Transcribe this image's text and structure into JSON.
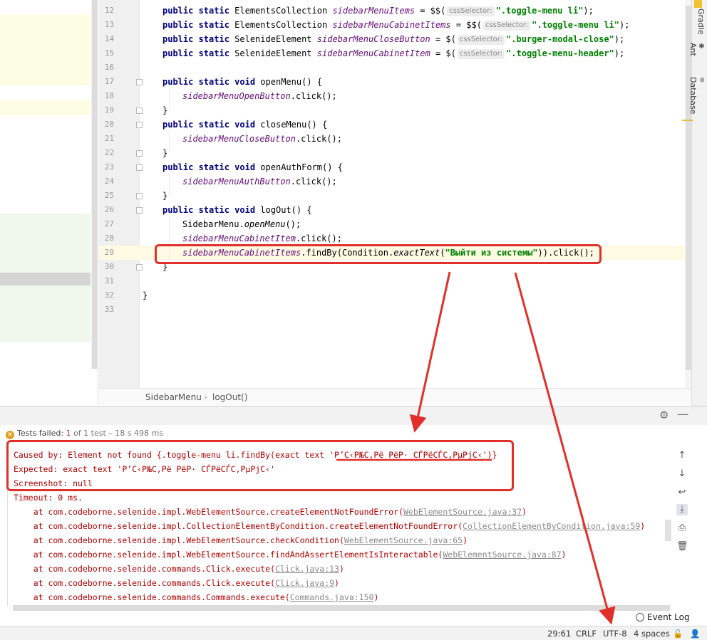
{
  "editor": {
    "lines": [
      {
        "num": "12"
      },
      {
        "num": "13"
      },
      {
        "num": "14"
      },
      {
        "num": "15"
      },
      {
        "num": "16"
      },
      {
        "num": "17"
      },
      {
        "num": "18"
      },
      {
        "num": "19"
      },
      {
        "num": "20"
      },
      {
        "num": "21"
      },
      {
        "num": "22"
      },
      {
        "num": "23"
      },
      {
        "num": "24"
      },
      {
        "num": "25"
      },
      {
        "num": "26"
      },
      {
        "num": "27"
      },
      {
        "num": "28"
      },
      {
        "num": "29"
      },
      {
        "num": "30"
      },
      {
        "num": "31"
      },
      {
        "num": "32"
      },
      {
        "num": "33"
      }
    ],
    "kw_public_static": "public static",
    "kw_void": "void",
    "t_elements_collection": "ElementsCollection",
    "t_selenide_element": "SelenideElement",
    "l12": {
      "field": "sidebarMenuItems",
      "op": " = $$(",
      "hint": "cssSelector:",
      "str": "\".toggle-menu li\"",
      "end": ");"
    },
    "l13": {
      "field": "sidebarMenuCabinetItems",
      "op": " = $$(",
      "hint": "cssSelector:",
      "str": "\".toggle-menu li\"",
      "end": ");"
    },
    "l14": {
      "field": "sidebarMenuCloseButton",
      "op": " = $(",
      "hint": "cssSelector:",
      "str": "\".burger-modal-close\"",
      "end": ");"
    },
    "l15": {
      "field": "sidebarMenuCabinetItem",
      "op": " = $(",
      "hint": "cssSelector:",
      "str": "\".toggle-menu-header\"",
      "end": ");"
    },
    "l17": {
      "method": "openMenu() {"
    },
    "l18": {
      "field": "sidebarMenuOpenButton",
      "rest": ".click();"
    },
    "l19": "}",
    "l20": {
      "method": "closeMenu() {"
    },
    "l21": {
      "field": "sidebarMenuCloseButton",
      "rest": ".click();"
    },
    "l22": "}",
    "l23": {
      "method": "openAuthForm() {"
    },
    "l24": {
      "field": "sidebarMenuAuthButton",
      "rest": ".click();"
    },
    "l25": "}",
    "l26": {
      "method": "logOut() {"
    },
    "l27": {
      "pre": "SidebarMenu.",
      "call": "openMenu",
      "rest": "();"
    },
    "l28": {
      "field": "sidebarMenuCabinetItem",
      "rest": ".click();"
    },
    "l29": {
      "field": "sidebarMenuCabinetItems",
      "a": ".findBy(Condition.",
      "call": "exactText",
      "b": "(",
      "str": "\"Выйти из системы\"",
      "c": ")).click();"
    },
    "l30": "}",
    "l32": "}"
  },
  "breadcrumb": {
    "class_name": "SidebarMenu",
    "separator": "›",
    "method": "logOut()"
  },
  "right_tools": {
    "gradle": "Gradle",
    "ant": "Ant",
    "database": "Database"
  },
  "run": {
    "status_label": "Tests failed:",
    "failed_count": "1",
    "status_rest": "of 1 test",
    "duration": "– 18 s 498 ms"
  },
  "console": {
    "caused_by_prefix": "Caused by: Element not found {.toggle-menu li.findBy(exact text ",
    "garbled_text": "'Р’С‹Р№С‚Рё РёР· СЃРёСЃС‚РµРјС‹'",
    "caused_by_suffix": ")}",
    "expected": "Expected: exact text 'Р’С‹Р№С‚Рё РёР· СЃРёСЃС‚РµРјС‹'",
    "screenshot": "Screenshot: null",
    "timeout": "Timeout: 0 ms.",
    "stack": [
      {
        "at": "    at com.codeborne.selenide.impl.WebElementSource.createElementNotFoundError(",
        "link": "WebElementSource.java:37",
        "end": ")"
      },
      {
        "at": "    at com.codeborne.selenide.impl.CollectionElementByCondition.createElementNotFoundError(",
        "link": "CollectionElementByCondition.java:59",
        "end": ")"
      },
      {
        "at": "    at com.codeborne.selenide.impl.WebElementSource.checkCondition(",
        "link": "WebElementSource.java:65",
        "end": ")"
      },
      {
        "at": "    at com.codeborne.selenide.impl.WebElementSource.findAndAssertElementIsInteractable(",
        "link": "WebElementSource.java:87",
        "end": ")"
      },
      {
        "at": "    at com.codeborne.selenide.commands.Click.execute(",
        "link": "Click.java:13",
        "end": ")"
      },
      {
        "at": "    at com.codeborne.selenide.commands.Click.execute(",
        "link": "Click.java:9",
        "end": ")"
      },
      {
        "at": "    at com.codeborne.selenide.commands.Commands.execute(",
        "link": "Commands.java:150",
        "end": ")"
      }
    ]
  },
  "status_bar": {
    "event_log": "Event Log",
    "position": "29:61",
    "line_sep": "CRLF",
    "encoding": "UTF-8",
    "indent": "4 spaces"
  },
  "colors": {
    "annotation_red": "#e1302a",
    "current_line": "#fffae3",
    "keyword": "#000080",
    "field": "#660e7a",
    "string": "#008000",
    "error_text": "#b00000"
  }
}
